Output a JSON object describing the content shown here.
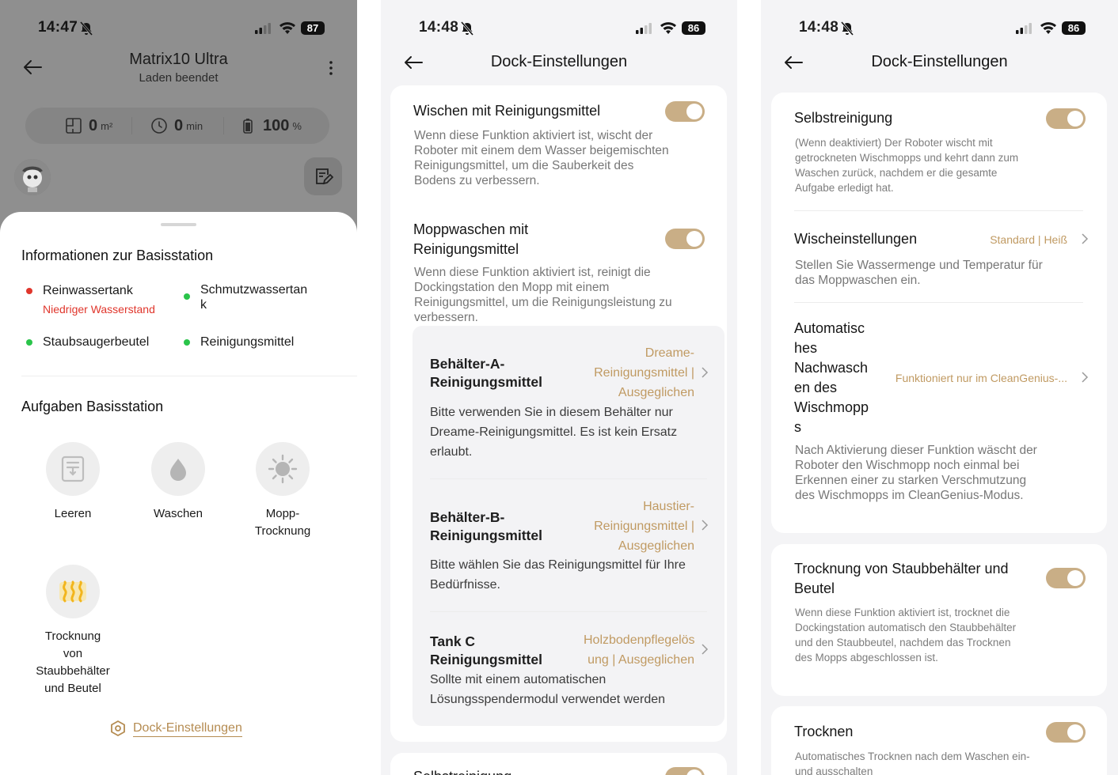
{
  "screen1": {
    "status": {
      "time": "14:47",
      "battery": "87"
    },
    "header": {
      "title": "Matrix10 Ultra",
      "subtitle": "Laden beendet"
    },
    "stats": [
      {
        "value": "0",
        "unit": "m²",
        "icon": "area-icon"
      },
      {
        "value": "0",
        "unit": "min",
        "icon": "clock-icon"
      },
      {
        "value": "100",
        "unit": "%",
        "icon": "battery-icon"
      }
    ],
    "info": {
      "title": "Informationen zur Basisstation",
      "items": [
        {
          "label": "Reinwassertank",
          "note": "Niedriger Wasserstand",
          "color": "#e0362c"
        },
        {
          "label": "Schmutzwassertan\nk",
          "note": "",
          "color": "#2ac44a"
        },
        {
          "label": "Staubsaugerbeutel",
          "note": "",
          "color": "#2ac44a"
        },
        {
          "label": "Reinigungsmittel",
          "note": "",
          "color": "#2ac44a"
        }
      ]
    },
    "tasks": {
      "title": "Aufgaben Basisstation",
      "items": [
        {
          "label": "Leeren",
          "icon": "empty-icon"
        },
        {
          "label": "Waschen",
          "icon": "water-drop-icon"
        },
        {
          "label": "Mopp-\nTrocknung",
          "icon": "sun-icon"
        },
        {
          "label": "Trocknung\nvon\nStaubbehälter\nund Beutel",
          "icon": "heat-icon"
        }
      ]
    },
    "dock_link": "Dock-Einstellungen"
  },
  "screen2": {
    "status": {
      "time": "14:48",
      "battery": "86"
    },
    "title": "Dock-Einstellungen",
    "wischen": {
      "title": "Wischen mit Reinigungsmittel",
      "desc": "Wenn diese Funktion aktiviert ist, wischt der Roboter mit einem dem Wasser beigemischten Reinigungsmittel, um die Sauberkeit des Bodens zu verbessern."
    },
    "moppwaschen": {
      "title": "Moppwaschen mit Reinigungsmittel",
      "desc": "Wenn diese Funktion aktiviert ist, reinigt die Dockingstation den Mopp mit einem Reinigungsmittel, um die Reinigungsleistung zu verbessern."
    },
    "containers": [
      {
        "title": "Behälter-A-\nReinigungsmittel",
        "value": "Dreame-\nReinigungsmittel |\nAusgeglichen",
        "desc": "Bitte verwenden Sie in diesem Behälter nur Dreame-Reinigungsmittel. Es ist kein Ersatz erlaubt."
      },
      {
        "title": "Behälter-B-\nReinigungsmittel",
        "value": "Haustier-\nReinigungsmittel |\nAusgeglichen",
        "desc": "Bitte wählen Sie das Reinigungsmittel für Ihre Bedürfnisse."
      },
      {
        "title": "Tank C\nReinigungsmittel",
        "value": "Holzbodenpflegelös\nung | Ausgeglichen",
        "desc": "Sollte mit einem automatischen Lösungsspendermodul verwendet werden"
      }
    ],
    "peek_title": "Selbstreinigung"
  },
  "screen3": {
    "status": {
      "time": "14:48",
      "battery": "86"
    },
    "title": "Dock-Einstellungen",
    "selbst": {
      "title": "Selbstreinigung",
      "desc": "(Wenn deaktiviert) Der Roboter wischt mit getrockneten Wischmopps und kehrt dann zum Waschen zurück, nachdem er die gesamte Aufgabe erledigt hat."
    },
    "wisch": {
      "title": "Wischeinstellungen",
      "value": "Standard | Heiß",
      "desc": "Stellen Sie Wassermenge und Temperatur für das Moppwaschen ein."
    },
    "auto": {
      "title": "Automatisc\nhes\nNachwasch\nen des\nWischmopp\ns",
      "value": "Funktioniert nur im CleanGenius-...",
      "desc": "Nach Aktivierung dieser Funktion wäscht der Roboter den Wischmopp noch einmal bei Erkennen einer zu starken Verschmutzung des Wischmopps im CleanGenius-Modus."
    },
    "trocknung": {
      "title": "Trocknung von Staubbehälter und Beutel",
      "desc": "Wenn diese Funktion aktiviert ist, trocknet die Dockingstation automatisch den Staubbehälter und den Staubbeutel, nachdem das Trocknen des Mopps abgeschlossen ist."
    },
    "trocknen": {
      "title": "Trocknen",
      "desc": "Automatisches Trocknen nach dem Waschen ein- und ausschalten"
    }
  }
}
